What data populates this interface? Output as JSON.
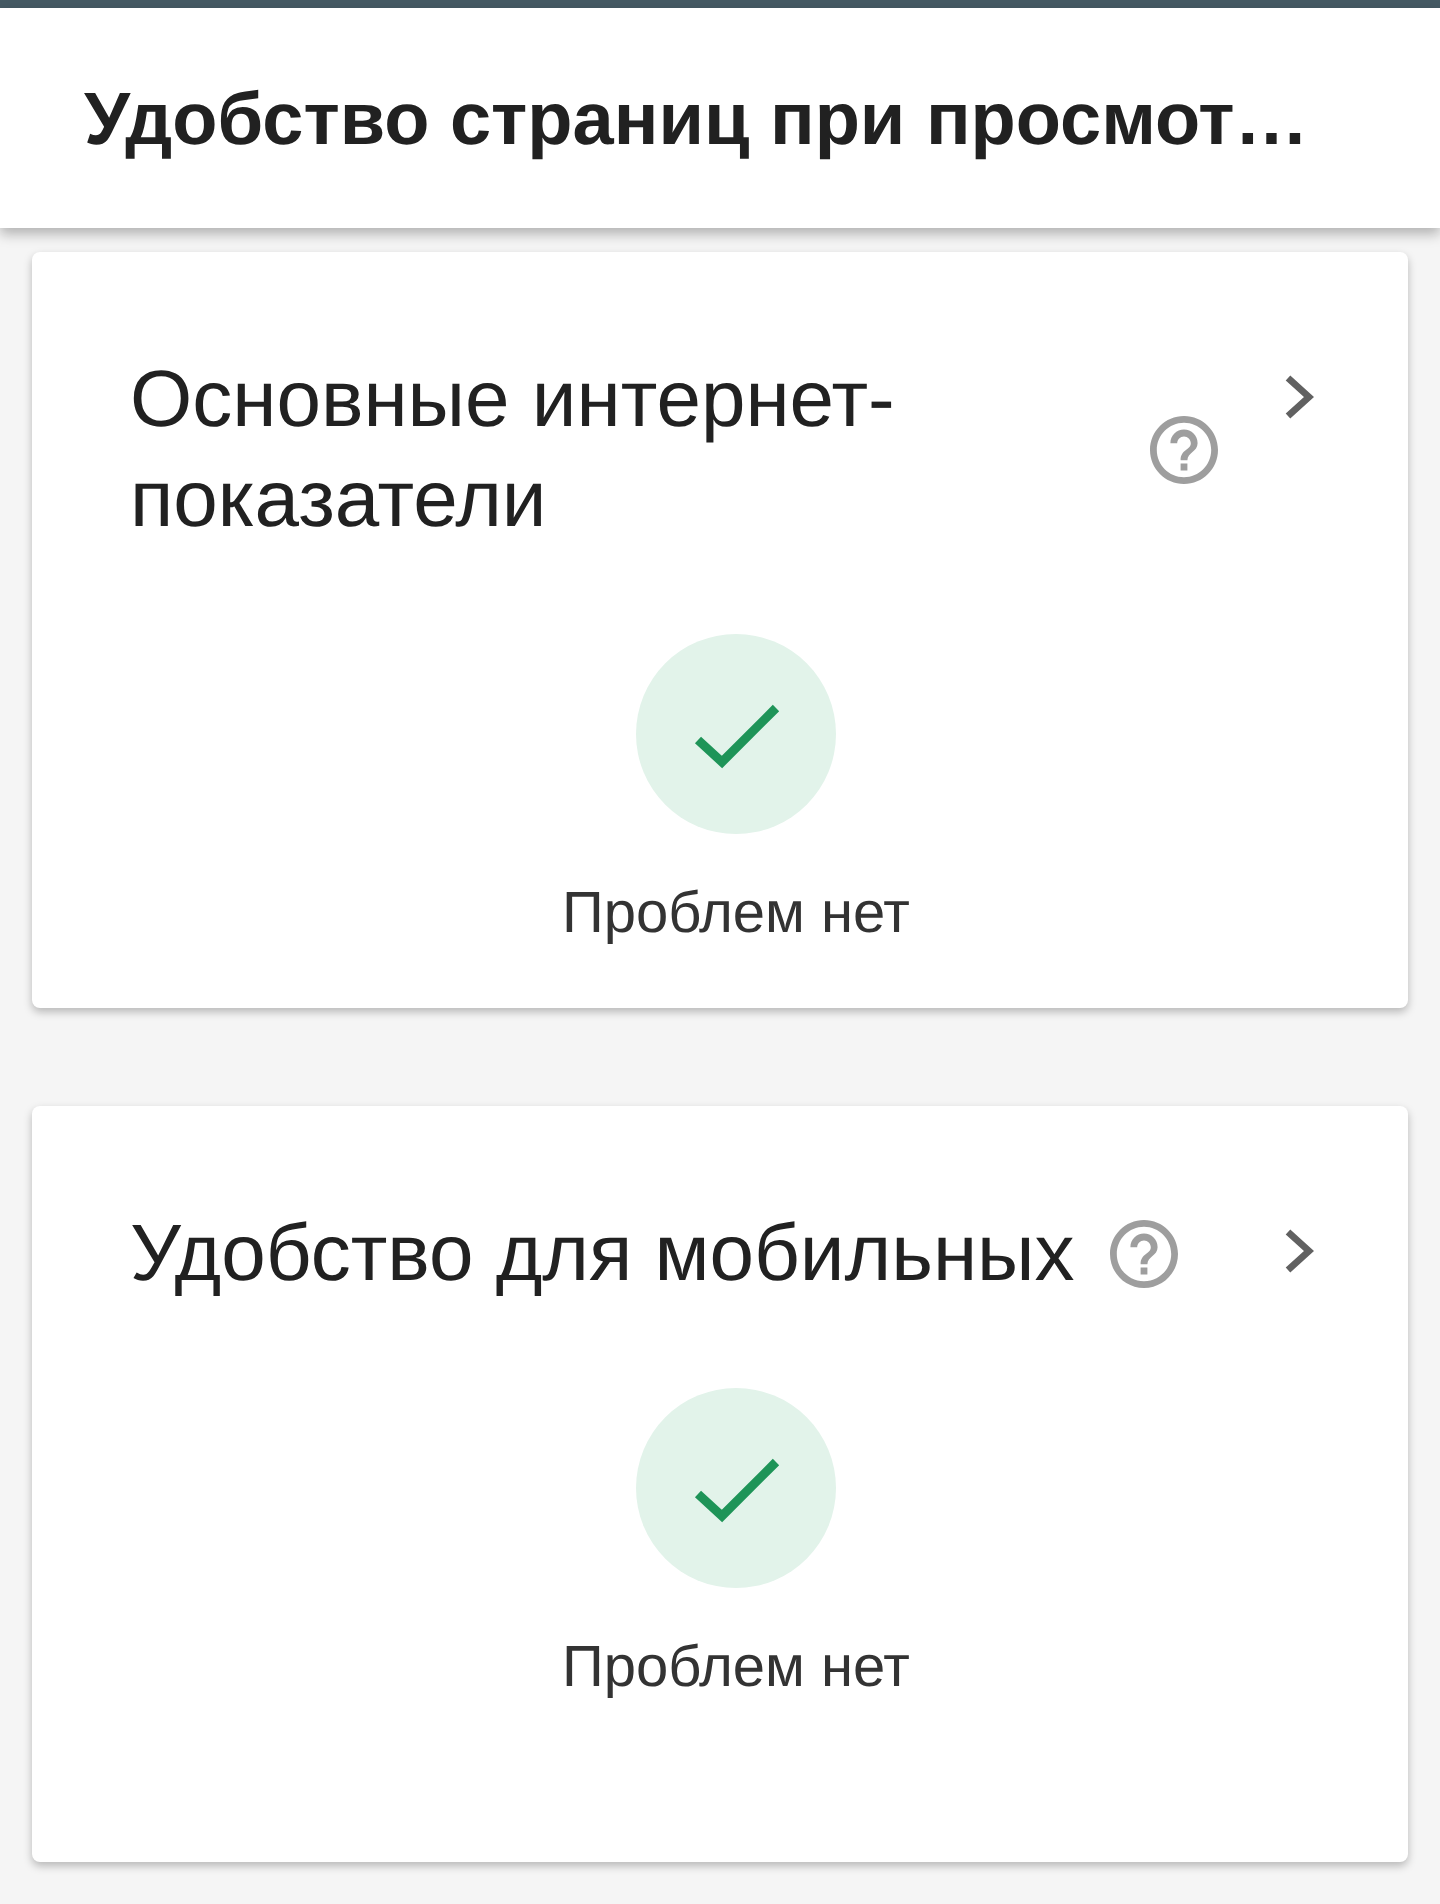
{
  "header": {
    "title": "Удобство страниц при просмот…"
  },
  "cards": [
    {
      "title": "Основные интернет-показатели",
      "status": "Проблем нет"
    },
    {
      "title": "Удобство для мобильных",
      "status": "Проблем нет"
    }
  ]
}
